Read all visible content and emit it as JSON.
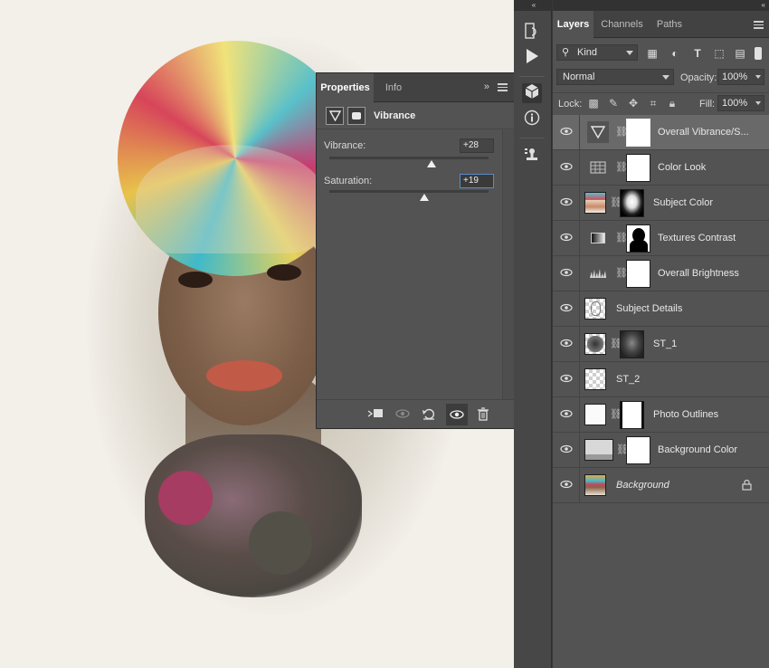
{
  "properties_panel": {
    "tabs": [
      "Properties",
      "Info"
    ],
    "collapse_glyph": "»",
    "title": "Vibrance",
    "vibrance": {
      "label": "Vibrance:",
      "value": "+28",
      "slider_percent": 64
    },
    "saturation": {
      "label": "Saturation:",
      "value": "+19",
      "slider_percent": 59.5
    },
    "footer_icons": [
      "clip-to-layer-icon",
      "view-previous-state-icon",
      "reset-icon",
      "visibility-icon",
      "delete-icon"
    ]
  },
  "toolstrip": {
    "collapse_glyph": "«",
    "icons": [
      "history-icon",
      "actions-play-icon",
      "3d-cube-icon",
      "info-icon",
      "clone-source-icon"
    ]
  },
  "layers_panel": {
    "collapse_glyph": "«",
    "tabs": [
      "Layers",
      "Channels",
      "Paths"
    ],
    "filter": {
      "label": "Kind",
      "icons": [
        "image-filter-icon",
        "adjustment-filter-icon",
        "type-filter-icon",
        "shape-filter-icon",
        "smart-object-filter-icon"
      ]
    },
    "blend_mode": "Normal",
    "opacity": {
      "label": "Opacity:",
      "value": "100%"
    },
    "lock": {
      "label": "Lock:",
      "icons": [
        "lock-transparent-icon",
        "lock-image-icon",
        "lock-position-icon",
        "lock-artboard-icon",
        "lock-all-icon"
      ]
    },
    "fill": {
      "label": "Fill:",
      "value": "100%"
    },
    "layers": [
      {
        "name": "Overall Vibrance/S...",
        "type": "adjustment",
        "icon": "vibrance-icon",
        "mask": "white",
        "selected": true
      },
      {
        "name": "Color Look",
        "type": "adjustment",
        "icon": "color-lookup-icon",
        "mask": "white"
      },
      {
        "name": "Subject Color",
        "type": "image",
        "mask": "subject"
      },
      {
        "name": "Textures Contrast",
        "type": "adjustment",
        "icon": "gradient-map-icon",
        "mask": "silhouette"
      },
      {
        "name": "Overall Brightness",
        "type": "adjustment",
        "icon": "levels-icon",
        "mask": "white"
      },
      {
        "name": "Subject Details",
        "type": "image-sketch"
      },
      {
        "name": "ST_1",
        "type": "image-dark",
        "mask": "dark"
      },
      {
        "name": "ST_2",
        "type": "transparent"
      },
      {
        "name": "Photo Outlines",
        "type": "image-white",
        "mask": "white"
      },
      {
        "name": "Background Color",
        "type": "fill",
        "mask": "white"
      },
      {
        "name": "Background",
        "type": "background",
        "locked": true
      }
    ]
  },
  "colors": {
    "panel": "#535353",
    "panel_dark": "#424242",
    "selected_row": "#696969",
    "accent_focus": "#5d8bc7"
  }
}
